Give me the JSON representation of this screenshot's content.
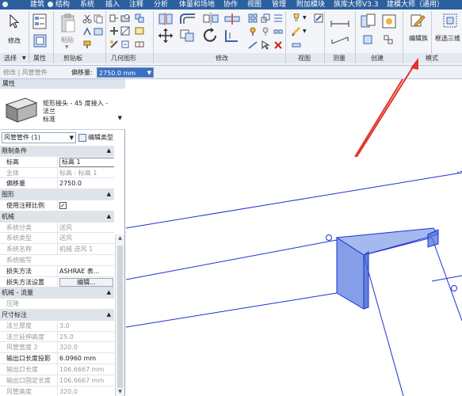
{
  "menubar": {
    "items": [
      "建筑",
      "结构",
      "系统",
      "插入",
      "注释",
      "分析",
      "体量和场地",
      "协作",
      "视图",
      "管理",
      "附加模块",
      "族库大师V3.3",
      "建模大师（通用）"
    ]
  },
  "ribbon": {
    "modify_label": "修改",
    "paste_label": "粘贴",
    "edit_family_label": "编辑族",
    "select_box_label": "框选三维",
    "panels": [
      "选择",
      "属性",
      "剪贴板",
      "几何图形",
      "修改",
      "视图",
      "测量",
      "创建",
      "模式"
    ]
  },
  "options_bar": {
    "context": "修改 | 风管管件",
    "offset_label": "偏移量:",
    "offset_value": "2750.0 mm"
  },
  "properties": {
    "title": "属性",
    "type_name_line1": "矩形接头 - 45 度接入 -",
    "type_name_line2": "法兰",
    "type_name_line3": "标准",
    "instance_combo": "风管管件 (1)",
    "edit_type_label": "编辑类型",
    "rows": [
      {
        "kind": "section",
        "name": "限制条件"
      },
      {
        "kind": "value",
        "name": "标高",
        "value": "标高 1",
        "style": "box"
      },
      {
        "kind": "grey",
        "name": "主体",
        "value": "标高 : 标高 1"
      },
      {
        "kind": "value",
        "name": "偏移量",
        "value": "2750.0"
      },
      {
        "kind": "section",
        "name": "图形"
      },
      {
        "kind": "check",
        "name": "使用注释比例",
        "value": "✓"
      },
      {
        "kind": "section",
        "name": "机械"
      },
      {
        "kind": "grey",
        "name": "系统分类",
        "value": "送风"
      },
      {
        "kind": "grey",
        "name": "系统类型",
        "value": "送风"
      },
      {
        "kind": "grey",
        "name": "系统名称",
        "value": "机械 送风 1"
      },
      {
        "kind": "grey",
        "name": "系统缩写",
        "value": ""
      },
      {
        "kind": "value",
        "name": "损失方法",
        "value": "ASHRAE 表..."
      },
      {
        "kind": "button",
        "name": "损失方法设置",
        "value": "编辑..."
      },
      {
        "kind": "section",
        "name": "机械 - 流量"
      },
      {
        "kind": "grey",
        "name": "压降",
        "value": ""
      },
      {
        "kind": "section",
        "name": "尺寸标注"
      },
      {
        "kind": "grey",
        "name": "法兰厚度",
        "value": "3.0"
      },
      {
        "kind": "grey",
        "name": "法兰延伸高度",
        "value": "25.0"
      },
      {
        "kind": "grey",
        "name": "风管宽度 2",
        "value": "320.0"
      },
      {
        "kind": "value",
        "name": "输出口长度投影",
        "value": "6.0960 mm"
      },
      {
        "kind": "grey",
        "name": "输出口长度",
        "value": "106.6667 mm"
      },
      {
        "kind": "grey",
        "name": "输出口固定长度",
        "value": "106.6667 mm"
      },
      {
        "kind": "grey",
        "name": "风管高度",
        "value": "320.0"
      }
    ]
  },
  "colors": {
    "menubar": "#2c5f9e",
    "selection_blue": "#3a70c4",
    "duct_line": "#1f2fd6",
    "arrow_red": "#e0352b"
  }
}
